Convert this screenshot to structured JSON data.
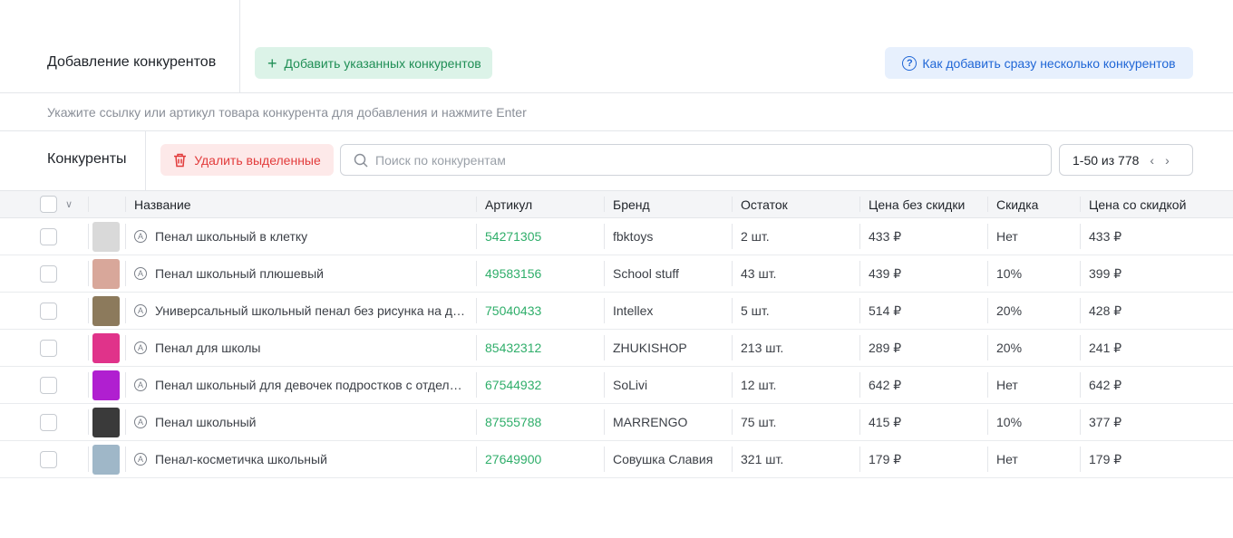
{
  "header": {
    "title": "Добавление конкурентов",
    "add_button": "Добавить указанных конкурентов",
    "help_button": "Как добавить сразу несколько конкурентов"
  },
  "hint": {
    "placeholder": "Укажите ссылку или артикул товара конкурента для добавления и нажмите Enter"
  },
  "toolbar": {
    "title": "Конкуренты",
    "delete_button": "Удалить выделенные",
    "search_placeholder": "Поиск по конкурентам",
    "pagination": "1-50 из 778"
  },
  "table": {
    "columns": [
      "Название",
      "Артикул",
      "Бренд",
      "Остаток",
      "Цена без скидки",
      "Скидка",
      "Цена со скидкой"
    ],
    "rows": [
      {
        "name": "Пенал школьный в клетку",
        "article": "54271305",
        "brand": "fbktoys",
        "stock": "2 шт.",
        "price": "433 ₽",
        "discount": "Нет",
        "final_price": "433 ₽",
        "thumb_color": "#d9d9d9"
      },
      {
        "name": "Пенал школьный плюшевый",
        "article": "49583156",
        "brand": "School stuff",
        "stock": "43 шт.",
        "price": "439 ₽",
        "discount": "10%",
        "final_price": "399 ₽",
        "thumb_color": "#d8a79a"
      },
      {
        "name": "Универсальный школьный пенал без рисунка на день у...",
        "article": "75040433",
        "brand": "Intellex",
        "stock": "5 шт.",
        "price": "514 ₽",
        "discount": "20%",
        "final_price": "428 ₽",
        "thumb_color": "#8c7a5c"
      },
      {
        "name": "Пенал для школы",
        "article": "85432312",
        "brand": "ZHUKISHOP",
        "stock": "213 шт.",
        "price": "289 ₽",
        "discount": "20%",
        "final_price": "241 ₽",
        "thumb_color": "#e0338a"
      },
      {
        "name": "Пенал школьный для девочек подростков с отделения...",
        "article": "67544932",
        "brand": "SoLivi",
        "stock": "12 шт.",
        "price": "642 ₽",
        "discount": "Нет",
        "final_price": "642 ₽",
        "thumb_color": "#b01fd0"
      },
      {
        "name": "Пенал школьный",
        "article": "87555788",
        "brand": "MARRENGO",
        "stock": "75 шт.",
        "price": "415 ₽",
        "discount": "10%",
        "final_price": "377 ₽",
        "thumb_color": "#3a3a3a"
      },
      {
        "name": "Пенал-косметичка школьный",
        "article": "27649900",
        "brand": "Совушка Славия",
        "stock": "321 шт.",
        "price": "179 ₽",
        "discount": "Нет",
        "final_price": "179 ₽",
        "thumb_color": "#9fb7c8"
      }
    ]
  },
  "icons": {
    "add": "plus-icon",
    "help": "question-circle-icon",
    "delete": "trash-icon",
    "search": "search-icon",
    "prev": "chevron-left-icon",
    "next": "chevron-right-icon",
    "row_marker": "circle-a-icon"
  },
  "colors": {
    "add_bg": "#dcf3e8",
    "add_text": "#1f8e55",
    "help_bg": "#e7f0fd",
    "help_text": "#1f66d6",
    "delete_bg": "#fde9e9",
    "delete_text": "#e23b3b",
    "article_text": "#2fae6a"
  }
}
